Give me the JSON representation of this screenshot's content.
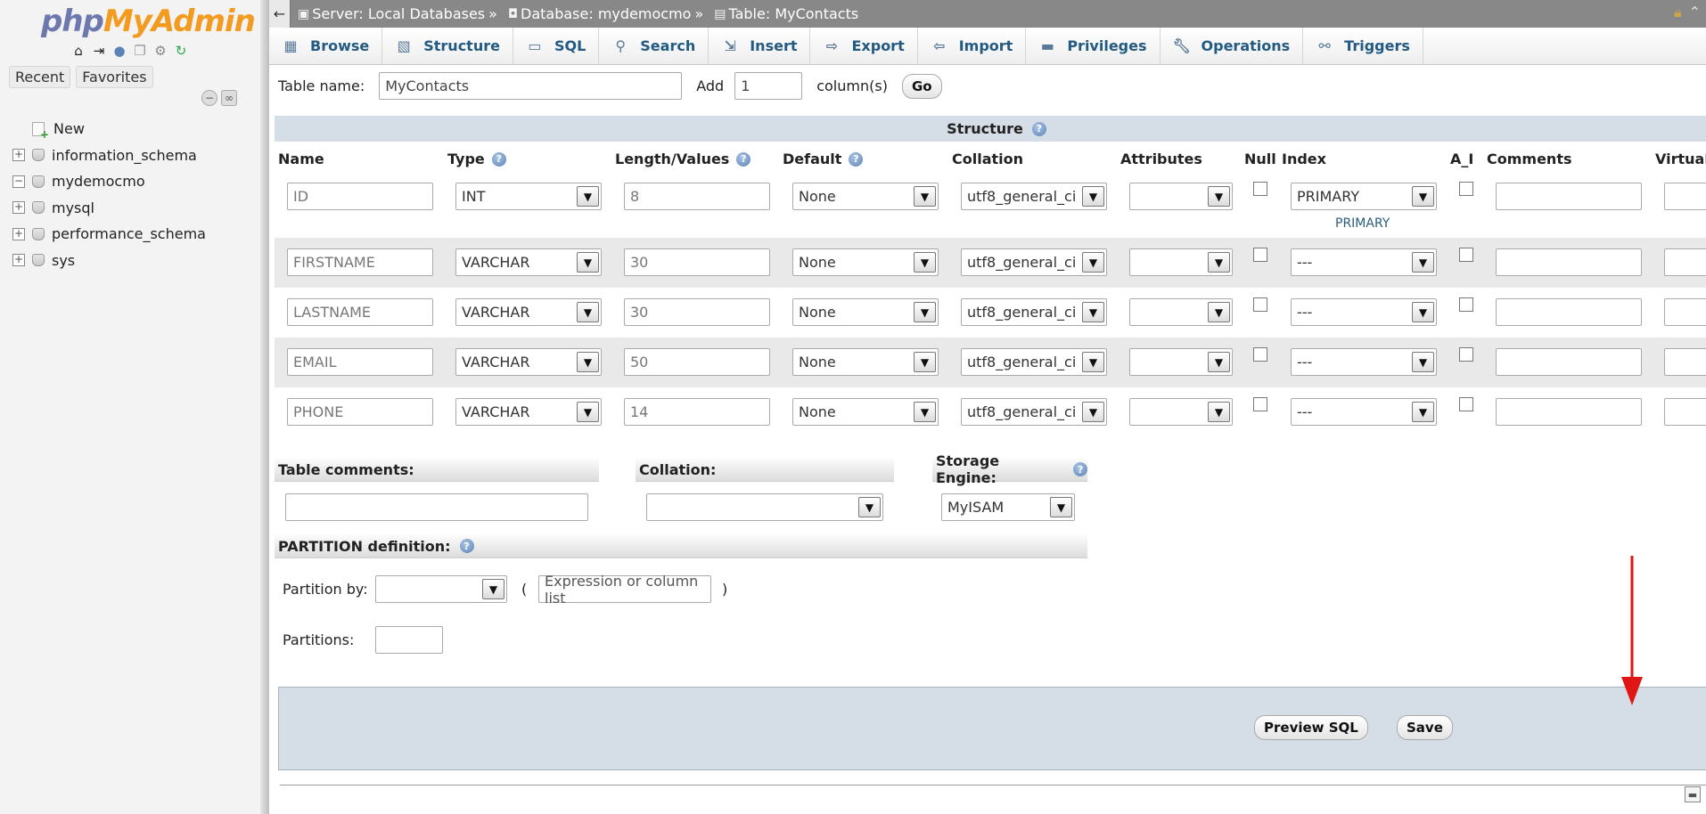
{
  "nav": {
    "logo_php": "php",
    "logo_myadmin": "MyAdmin",
    "tabs": [
      "Recent",
      "Favorites"
    ],
    "tree": [
      {
        "label": "New",
        "type": "new"
      },
      {
        "label": "information_schema",
        "type": "db",
        "expander": "+"
      },
      {
        "label": "mydemocmo",
        "type": "db",
        "expander": "−"
      },
      {
        "label": "mysql",
        "type": "db",
        "expander": "+"
      },
      {
        "label": "performance_schema",
        "type": "db",
        "expander": "+"
      },
      {
        "label": "sys",
        "type": "db",
        "expander": "+"
      }
    ]
  },
  "breadcrumb": {
    "server": "Server: Local Databases",
    "database": "Database: mydemocmo",
    "table": "Table: MyContacts",
    "sep": "»"
  },
  "tabs": [
    "Browse",
    "Structure",
    "SQL",
    "Search",
    "Insert",
    "Export",
    "Import",
    "Privileges",
    "Operations",
    "Triggers"
  ],
  "form": {
    "table_name_label": "Table name:",
    "table_name_value": "MyContacts",
    "add_label": "Add",
    "add_value": "1",
    "columns_label": "column(s)",
    "go_label": "Go",
    "structure_label": "Structure",
    "headers": {
      "name": "Name",
      "type": "Type",
      "length": "Length/Values",
      "default": "Default",
      "collation": "Collation",
      "attributes": "Attributes",
      "null": "Null",
      "index": "Index",
      "ai": "A_I",
      "comments": "Comments",
      "virtuality": "Virtuali"
    },
    "rows": [
      {
        "name": "ID",
        "type": "INT",
        "length": "8",
        "default": "None",
        "collation": "utf8_general_ci",
        "index": "PRIMARY",
        "index_note": "PRIMARY"
      },
      {
        "name": "FIRSTNAME",
        "type": "VARCHAR",
        "length": "30",
        "default": "None",
        "collation": "utf8_general_ci",
        "index": "---",
        "index_note": ""
      },
      {
        "name": "LASTNAME",
        "type": "VARCHAR",
        "length": "30",
        "default": "None",
        "collation": "utf8_general_ci",
        "index": "---",
        "index_note": ""
      },
      {
        "name": "EMAIL",
        "type": "VARCHAR",
        "length": "50",
        "default": "None",
        "collation": "utf8_general_ci",
        "index": "---",
        "index_note": ""
      },
      {
        "name": "PHONE",
        "type": "VARCHAR",
        "length": "14",
        "default": "None",
        "collation": "utf8_general_ci",
        "index": "---",
        "index_note": ""
      }
    ],
    "table_comments_label": "Table comments:",
    "collation_label": "Collation:",
    "storage_engine_label": "Storage Engine:",
    "storage_engine_value": "MyISAM",
    "partition_label": "PARTITION definition:",
    "partition_by_label": "Partition by:",
    "expression_placeholder": "Expression or column list",
    "paren_open": "(",
    "paren_close": ")",
    "partitions_label": "Partitions:",
    "preview_sql_label": "Preview SQL",
    "save_label": "Save"
  },
  "colors": {
    "accent_arrow": "#e01515",
    "link": "#235a81"
  }
}
